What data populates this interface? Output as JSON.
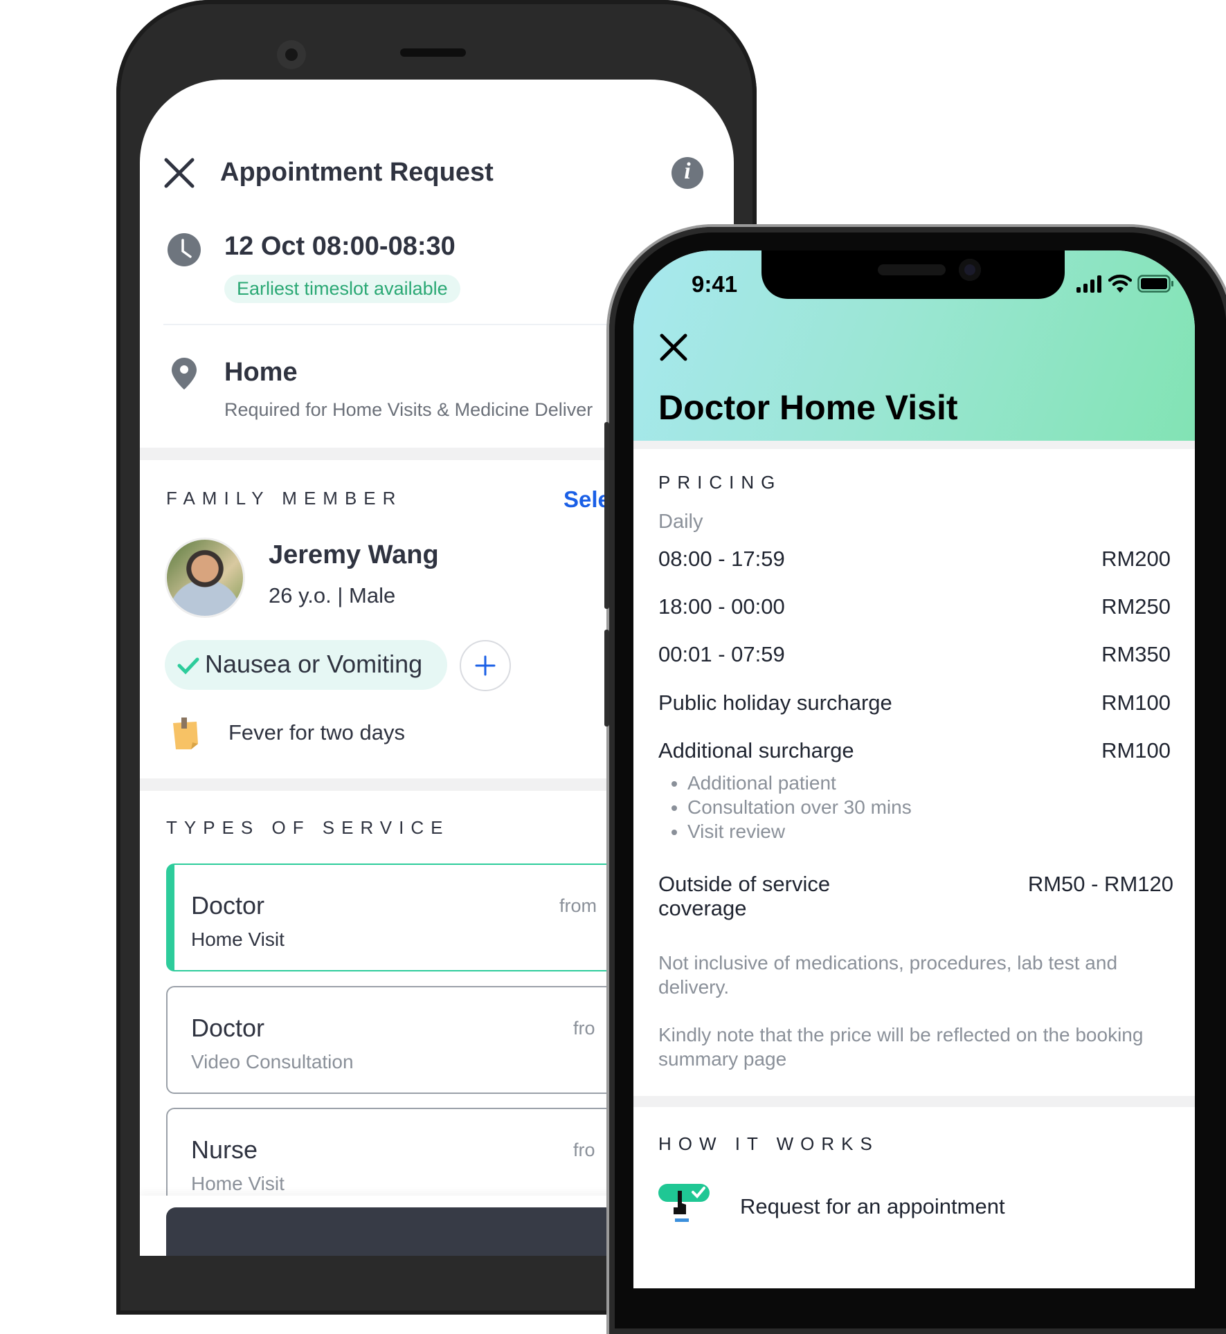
{
  "left_screen": {
    "header": {
      "title": "Appointment Request",
      "close_icon": "close-icon",
      "info_icon": "info-icon"
    },
    "timeslot": {
      "datetime": "12 Oct 08:00-08:30",
      "badge": "Earliest timeslot available"
    },
    "location": {
      "title": "Home",
      "subtitle": "Required for Home Visits & Medicine Deliver"
    },
    "family_member": {
      "section_label": "FAMILY MEMBER",
      "select_link": "Sele",
      "name": "Jeremy Wang",
      "details": "26 y.o. | Male",
      "symptom_chip": "Nausea or Vomiting",
      "note": "Fever for two days"
    },
    "types_of_service": {
      "section_label": "TYPES OF SERVICE",
      "items": [
        {
          "title": "Doctor",
          "subtitle": "Home Visit",
          "price_prefix": "from",
          "selected": true
        },
        {
          "title": "Doctor",
          "subtitle": "Video Consultation",
          "price_prefix": "fro",
          "selected": false
        },
        {
          "title": "Nurse",
          "subtitle": "Home Visit",
          "price_prefix": "fro",
          "selected": false
        }
      ]
    }
  },
  "right_screen": {
    "status_bar": {
      "time": "9:41"
    },
    "header": {
      "title": "Doctor Home Visit"
    },
    "pricing": {
      "section_label": "PRICING",
      "group_label": "Daily",
      "rows": [
        {
          "label": "08:00 - 17:59",
          "price": "RM200"
        },
        {
          "label": "18:00 - 00:00",
          "price": "RM250"
        },
        {
          "label": "00:01 - 07:59",
          "price": "RM350"
        },
        {
          "label": "Public holiday surcharge",
          "price": "RM100"
        },
        {
          "label": "Additional surcharge",
          "price": "RM100"
        }
      ],
      "surcharge_bullets": [
        "Additional patient",
        "Consultation over 30 mins",
        "Visit review"
      ],
      "outside_label": "Outside of service coverage",
      "outside_price": "RM50 - RM120",
      "note1": "Not inclusive of medications, procedures, lab test and delivery.",
      "note2": "Kindly note that the price will be reflected on the booking summary page"
    },
    "how_it_works": {
      "section_label": "HOW IT WORKS",
      "steps": [
        {
          "label": "Request for an appointment",
          "icon": "tap-check-icon"
        }
      ]
    }
  },
  "colors": {
    "accent_green": "#2dcc9b",
    "badge_green_text": "#2aa874",
    "badge_green_bg": "#e8f8f4",
    "link_blue": "#1a5fe6",
    "dark_text": "#2f3340"
  }
}
